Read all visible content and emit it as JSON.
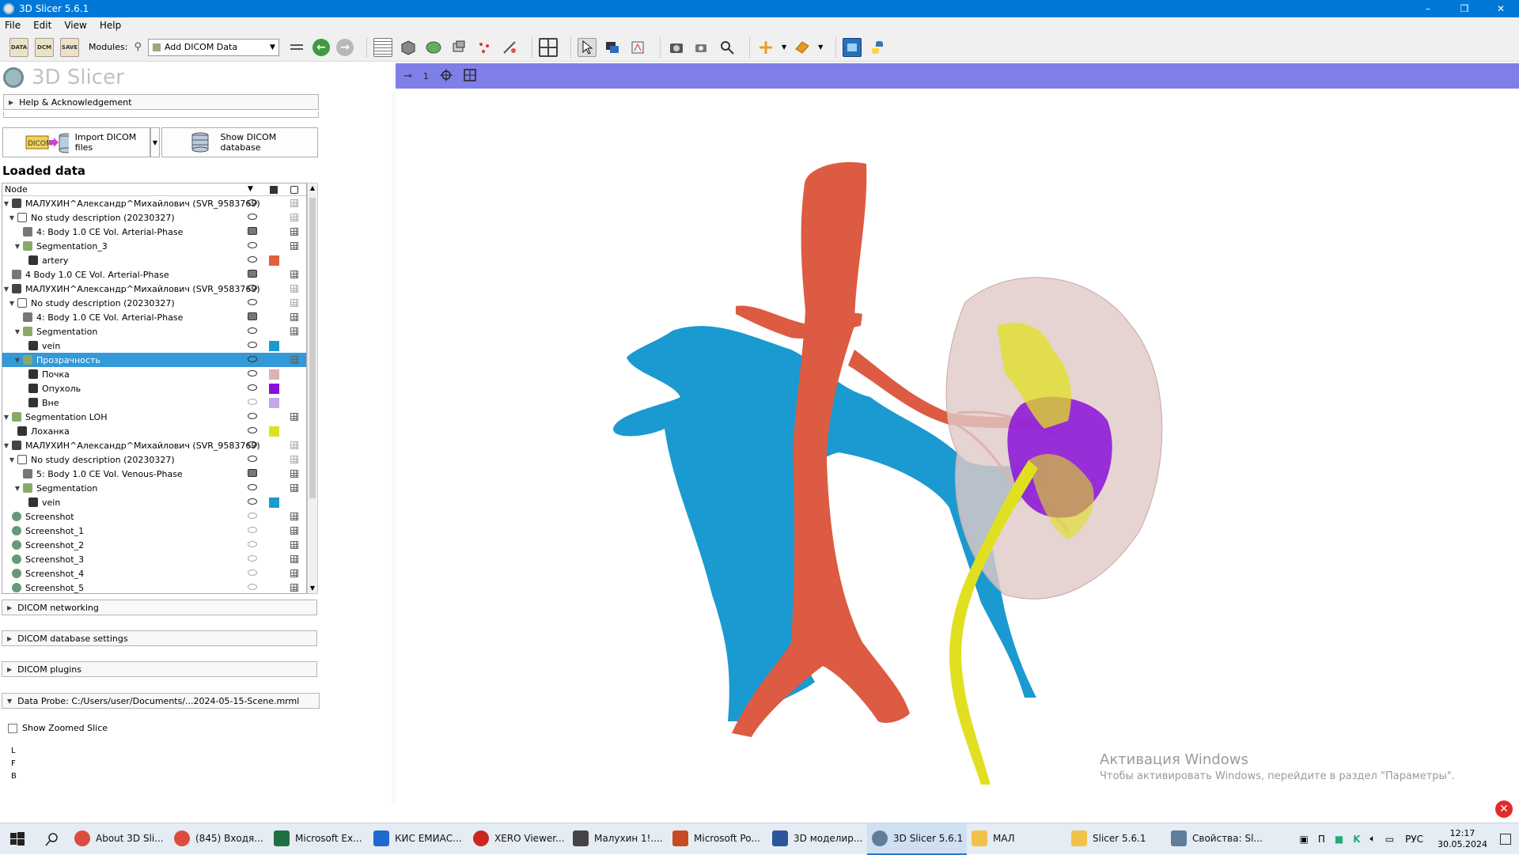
{
  "window": {
    "title": "3D Slicer 5.6.1",
    "minimize": "–",
    "restore": "❐",
    "close": "✕"
  },
  "menu": [
    "File",
    "Edit",
    "View",
    "Help"
  ],
  "toolbar": {
    "data_label": "DATA",
    "dcm_label": "DCM",
    "save_label": "SAVE",
    "modules_label": "Modules:",
    "module_selected": "Add DICOM Data",
    "back_glyph": "←",
    "forward_glyph": "→"
  },
  "panel": {
    "logo_text": "3D Slicer",
    "help_section": "Help & Acknowledgement",
    "import_button": "Import DICOM files",
    "import_icon_text": "DICOM",
    "show_db_button": "Show DICOM database",
    "loaded_data_title": "Loaded data",
    "tree_header_node": "Node",
    "sections": {
      "networking": "DICOM networking",
      "db_settings": "DICOM database settings",
      "plugins": "DICOM plugins",
      "data_probe": "Data Probe: C:/Users/user/Documents/...2024-05-15-Scene.mrml"
    },
    "show_zoomed_slice": "Show Zoomed Slice",
    "probe_lines": [
      "L",
      "F",
      "B"
    ]
  },
  "tree_rows": [
    {
      "label": "МАЛУХИН^Александр^Михайлович (SVR_9583769)",
      "level": 0,
      "toggle": "▼",
      "type": "patient",
      "eye": "on",
      "swatch": "",
      "grid": "study"
    },
    {
      "label": "No study description (20230327)",
      "level": 1,
      "toggle": "▼",
      "type": "study",
      "eye": "on",
      "swatch": "",
      "grid": "study"
    },
    {
      "label": "4: Body 1.0 CE  Vol. Arterial-Phase",
      "level": 2,
      "toggle": "",
      "type": "volume",
      "eye": "vol",
      "swatch": "",
      "grid": "grid"
    },
    {
      "label": "Segmentation_3",
      "level": 2,
      "toggle": "▼",
      "type": "segmentation",
      "eye": "on",
      "swatch": "",
      "grid": "grid"
    },
    {
      "label": "artery",
      "level": 3,
      "toggle": "",
      "type": "segment",
      "eye": "on",
      "swatch": "#e06040",
      "grid": ""
    },
    {
      "label": "4 Body 1.0 CE  Vol. Arterial-Phase",
      "level": 0,
      "toggle": "",
      "type": "volume",
      "eye": "vol",
      "swatch": "",
      "grid": "grid"
    },
    {
      "label": "МАЛУХИН^Александр^Михайлович (SVR_9583769)",
      "level": 0,
      "toggle": "▼",
      "type": "patient",
      "eye": "on",
      "swatch": "",
      "grid": "study"
    },
    {
      "label": "No study description (20230327)",
      "level": 1,
      "toggle": "▼",
      "type": "study",
      "eye": "on",
      "swatch": "",
      "grid": "study"
    },
    {
      "label": "4: Body 1.0 CE  Vol. Arterial-Phase",
      "level": 2,
      "toggle": "",
      "type": "volume",
      "eye": "vol",
      "swatch": "",
      "grid": "grid"
    },
    {
      "label": "Segmentation",
      "level": 2,
      "toggle": "▼",
      "type": "segmentation",
      "eye": "on",
      "swatch": "",
      "grid": "grid"
    },
    {
      "label": "vein",
      "level": 3,
      "toggle": "",
      "type": "segment",
      "eye": "on",
      "swatch": "#1a9ad0",
      "grid": ""
    },
    {
      "label": "Прозрачность",
      "level": 2,
      "toggle": "▼",
      "type": "segmentation",
      "eye": "on",
      "swatch": "",
      "grid": "grid",
      "selected": true
    },
    {
      "label": "Почка",
      "level": 3,
      "toggle": "",
      "type": "segment",
      "eye": "on",
      "swatch": "#e0b3b3",
      "grid": ""
    },
    {
      "label": "Опухоль",
      "level": 3,
      "toggle": "",
      "type": "segment",
      "eye": "on",
      "swatch": "#8a10d8",
      "grid": ""
    },
    {
      "label": "Вне",
      "level": 3,
      "toggle": "",
      "type": "segment",
      "eye": "off",
      "swatch": "#c6a8e8",
      "grid": ""
    },
    {
      "label": "Segmentation LOH",
      "level": 0,
      "toggle": "▼",
      "type": "segmentation",
      "eye": "on",
      "swatch": "",
      "grid": "grid"
    },
    {
      "label": "Лоханка",
      "level": 1,
      "toggle": "",
      "type": "segment",
      "eye": "on",
      "swatch": "#e0e020",
      "grid": ""
    },
    {
      "label": "МАЛУХИН^Александр^Михайлович (SVR_9583769)",
      "level": 0,
      "toggle": "▼",
      "type": "patient",
      "eye": "on",
      "swatch": "",
      "grid": "study"
    },
    {
      "label": "No study description (20230327)",
      "level": 1,
      "toggle": "▼",
      "type": "study",
      "eye": "on",
      "swatch": "",
      "grid": "study"
    },
    {
      "label": "5: Body 1.0 CE  Vol. Venous-Phase",
      "level": 2,
      "toggle": "",
      "type": "volume",
      "eye": "vol",
      "swatch": "",
      "grid": "grid"
    },
    {
      "label": "Segmentation",
      "level": 2,
      "toggle": "▼",
      "type": "segmentation",
      "eye": "on",
      "swatch": "",
      "grid": "grid"
    },
    {
      "label": "vein",
      "level": 3,
      "toggle": "",
      "type": "segment",
      "eye": "on",
      "swatch": "#1a9ad0",
      "grid": ""
    },
    {
      "label": "Screenshot",
      "level": 0,
      "toggle": "",
      "type": "screenshot",
      "eye": "off",
      "swatch": "",
      "grid": "grid"
    },
    {
      "label": "Screenshot_1",
      "level": 0,
      "toggle": "",
      "type": "screenshot",
      "eye": "off",
      "swatch": "",
      "grid": "grid"
    },
    {
      "label": "Screenshot_2",
      "level": 0,
      "toggle": "",
      "type": "screenshot",
      "eye": "off",
      "swatch": "",
      "grid": "grid"
    },
    {
      "label": "Screenshot_3",
      "level": 0,
      "toggle": "",
      "type": "screenshot",
      "eye": "off",
      "swatch": "",
      "grid": "grid"
    },
    {
      "label": "Screenshot_4",
      "level": 0,
      "toggle": "",
      "type": "screenshot",
      "eye": "off",
      "swatch": "",
      "grid": "grid"
    },
    {
      "label": "Screenshot_5",
      "level": 0,
      "toggle": "",
      "type": "screenshot",
      "eye": "off",
      "swatch": "",
      "grid": "grid"
    }
  ],
  "view": {
    "pin_glyph": "⊸",
    "view_number": "1"
  },
  "watermark": {
    "line1": "Активация Windows",
    "line2": "Чтобы активировать Windows, перейдите в раздел \"Параметры\"."
  },
  "taskbar": {
    "items": [
      {
        "label": "About 3D Sli...",
        "color": "#dd4b3e",
        "icon": "chrome-icon"
      },
      {
        "label": "(845) Входя...",
        "color": "#dd4b3e",
        "icon": "chrome-icon"
      },
      {
        "label": "Microsoft Ex...",
        "color": "#1e7145",
        "icon": "excel-icon"
      },
      {
        "label": "КИС ЕМИАС...",
        "color": "#1f6ad2",
        "icon": "app-icon"
      },
      {
        "label": "XERO Viewer...",
        "color": "#c8281f",
        "icon": "xero-icon"
      },
      {
        "label": "Малухин 1!....",
        "color": "#444444",
        "icon": "photos-icon"
      },
      {
        "label": "Microsoft Po...",
        "color": "#c84a25",
        "icon": "powerpoint-icon"
      },
      {
        "label": "3D моделир...",
        "color": "#2b579a",
        "icon": "word-icon"
      },
      {
        "label": "3D Slicer 5.6.1",
        "color": "#5f7e9a",
        "icon": "slicer-icon",
        "active": true
      },
      {
        "label": "МАЛ",
        "color": "#f0c24a",
        "icon": "folder-icon"
      },
      {
        "label": "Slicer 5.6.1",
        "color": "#f0c24a",
        "icon": "folder-icon"
      },
      {
        "label": "Свойства: Sl...",
        "color": "#5f7e9a",
        "icon": "properties-icon"
      }
    ],
    "lang": "РУС",
    "time": "12:17",
    "date": "30.05.2024"
  }
}
